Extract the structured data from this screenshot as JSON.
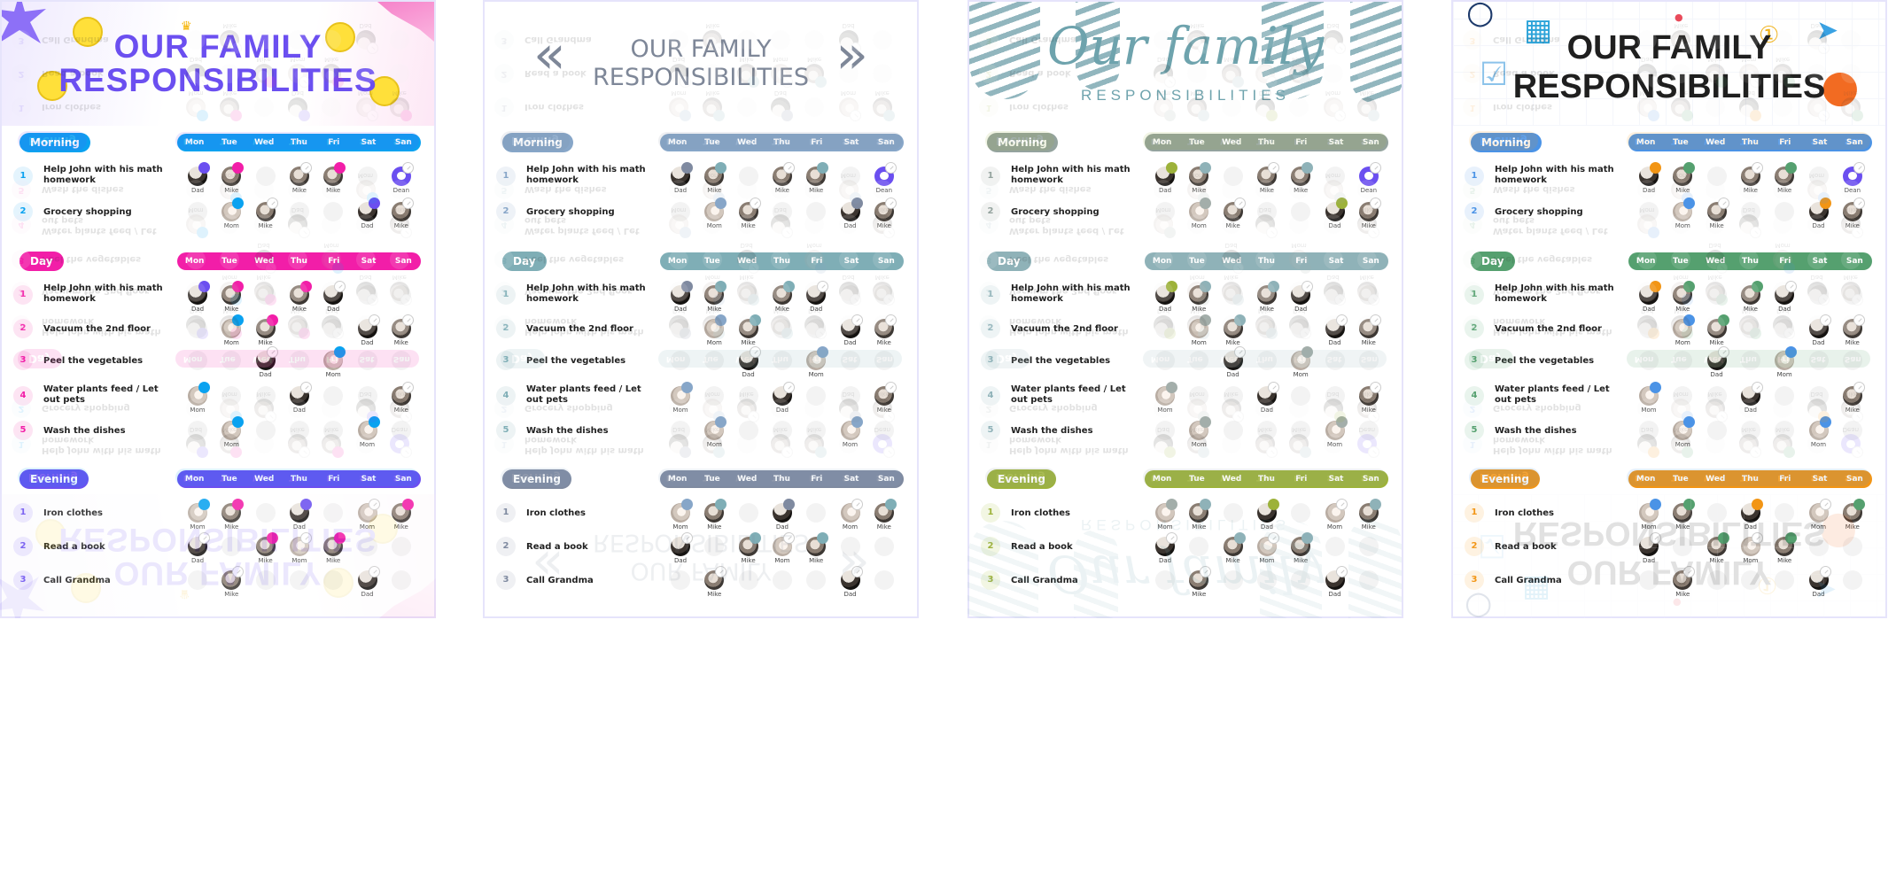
{
  "days": [
    "Mon",
    "Tue",
    "Wed",
    "Thu",
    "Fri",
    "Sat",
    "San"
  ],
  "sections": [
    {
      "key": "morning",
      "label": "Morning",
      "tasks": [
        {
          "n": "1",
          "text": "Help John with his math homework",
          "cells": [
            {
              "who": "Dad",
              "badge": "c1"
            },
            {
              "who": "Mike",
              "badge": "c2"
            },
            null,
            {
              "who": "Mike",
              "badge": "check"
            },
            {
              "who": "Mike",
              "badge": "c2"
            },
            null,
            {
              "who": "Dean",
              "badge": "check"
            }
          ]
        },
        {
          "n": "2",
          "text": "Grocery shopping",
          "cells": [
            null,
            {
              "who": "Mom",
              "badge": "c3"
            },
            {
              "who": "Mike",
              "badge": "check"
            },
            null,
            null,
            {
              "who": "Dad",
              "badge": "c1"
            },
            {
              "who": "Mike",
              "badge": "check"
            }
          ]
        }
      ]
    },
    {
      "key": "day",
      "label": "Day",
      "tasks": [
        {
          "n": "1",
          "text": "Help John with his math homework",
          "cells": [
            {
              "who": "Dad",
              "badge": "c1"
            },
            {
              "who": "Mike",
              "badge": "c2"
            },
            null,
            {
              "who": "Mike",
              "badge": "c2"
            },
            {
              "who": "Dad",
              "badge": "check"
            },
            null,
            null
          ]
        },
        {
          "n": "2",
          "text": "Vacuum the 2nd floor",
          "cells": [
            null,
            {
              "who": "Mom",
              "badge": "c3"
            },
            {
              "who": "Mike",
              "badge": "c2"
            },
            null,
            null,
            {
              "who": "Dad",
              "badge": "check"
            },
            {
              "who": "Mike",
              "badge": "check"
            }
          ]
        },
        {
          "n": "3",
          "text": "Peel the vegetables",
          "cells": [
            null,
            null,
            {
              "who": "Dad",
              "badge": "check"
            },
            null,
            {
              "who": "Mom",
              "badge": "c3"
            },
            null,
            null
          ]
        },
        {
          "n": "4",
          "text": "Water plants feed / Let out pets",
          "cells": [
            {
              "who": "Mom",
              "badge": "c3"
            },
            null,
            null,
            {
              "who": "Dad",
              "badge": "check"
            },
            null,
            null,
            {
              "who": "Mike",
              "badge": "check"
            }
          ]
        },
        {
          "n": "5",
          "text": "Wash the dishes",
          "cells": [
            null,
            {
              "who": "Mom",
              "badge": "c3"
            },
            null,
            null,
            null,
            {
              "who": "Mom",
              "badge": "c3"
            },
            null
          ]
        }
      ]
    },
    {
      "key": "evening",
      "label": "Evening",
      "tasks": [
        {
          "n": "1",
          "text": "Iron clothes",
          "cells": [
            {
              "who": "Mom",
              "badge": "c3"
            },
            {
              "who": "Mike",
              "badge": "c2"
            },
            null,
            {
              "who": "Dad",
              "badge": "c1"
            },
            null,
            {
              "who": "Mom",
              "badge": "check"
            },
            {
              "who": "Mike",
              "badge": "c2"
            }
          ]
        },
        {
          "n": "2",
          "text": "Read a book",
          "cells": [
            {
              "who": "Dad",
              "badge": "check"
            },
            null,
            {
              "who": "Mike",
              "badge": "c2"
            },
            {
              "who": "Mom",
              "badge": "check"
            },
            {
              "who": "Mike",
              "badge": "c2"
            },
            null,
            null
          ]
        },
        {
          "n": "3",
          "text": "Call Grandma",
          "cells": [
            null,
            {
              "who": "Mike",
              "badge": "check"
            },
            null,
            null,
            null,
            {
              "who": "Dad",
              "badge": "check"
            },
            null
          ]
        }
      ]
    }
  ],
  "templates": [
    {
      "id": "playful",
      "title_line1": "OUR FAMILY",
      "title_line2": "RESPONSIBILITIES",
      "colors": {
        "morning": "#0aa2f0",
        "day": "#f21ea8",
        "evening": "#6b4ff0",
        "num_morning_bg": "#e4f4fd",
        "num_day_bg": "#fde4f3",
        "num_evening_bg": "#ece8fd",
        "c1": "#6b4ff0",
        "c2": "#f21ea8",
        "c3": "#0aa2f0"
      },
      "decorations": [
        "star-burst",
        "smiley-face",
        "crown",
        "smiley-face",
        "smiley-face",
        "smiley-face"
      ]
    },
    {
      "id": "minimal",
      "title_line1": "OUR FAMILY",
      "title_line2": "RESPONSIBILITIES",
      "colors": {
        "morning": "#87a6c8",
        "day": "#7faeb6",
        "evening": "#7f8aa0",
        "num_morning_bg": "#eef2f7",
        "num_day_bg": "#edf3f4",
        "num_evening_bg": "#eff0f3",
        "c1": "#7f8aa0",
        "c2": "#7faeb6",
        "c3": "#87a6c8"
      },
      "decorations": [
        "double-chevron-left",
        "double-chevron-right"
      ]
    },
    {
      "id": "botanical",
      "title_line1": "Our family",
      "title_line2": "RESPONSIBILITIES",
      "colors": {
        "morning": "#94a39e",
        "day": "#8fb2b8",
        "evening": "#9db23a",
        "num_morning_bg": "#f1f2f1",
        "num_day_bg": "#eef4f5",
        "num_evening_bg": "#f2f6e3",
        "c1": "#9db23a",
        "c2": "#8fb2b8",
        "c3": "#a3aeaa"
      },
      "decorations": [
        "leaf-branch",
        "leaf-branch",
        "leaf-branch"
      ]
    },
    {
      "id": "school",
      "title_line1": "OUR FAMILY",
      "title_line2": "RESPONSIBILITIES",
      "colors": {
        "morning": "#4b93e6",
        "day": "#55a06f",
        "evening": "#f29515",
        "num_morning_bg": "#e8f1fc",
        "num_day_bg": "#e9f4ed",
        "num_evening_bg": "#fef2e1",
        "c1": "#f29515",
        "c2": "#55a06f",
        "c3": "#4b93e6"
      },
      "decorations": [
        "magnifier",
        "calculator",
        "checklist",
        "map-pin",
        "medal",
        "paper-plane",
        "basketball"
      ]
    }
  ]
}
